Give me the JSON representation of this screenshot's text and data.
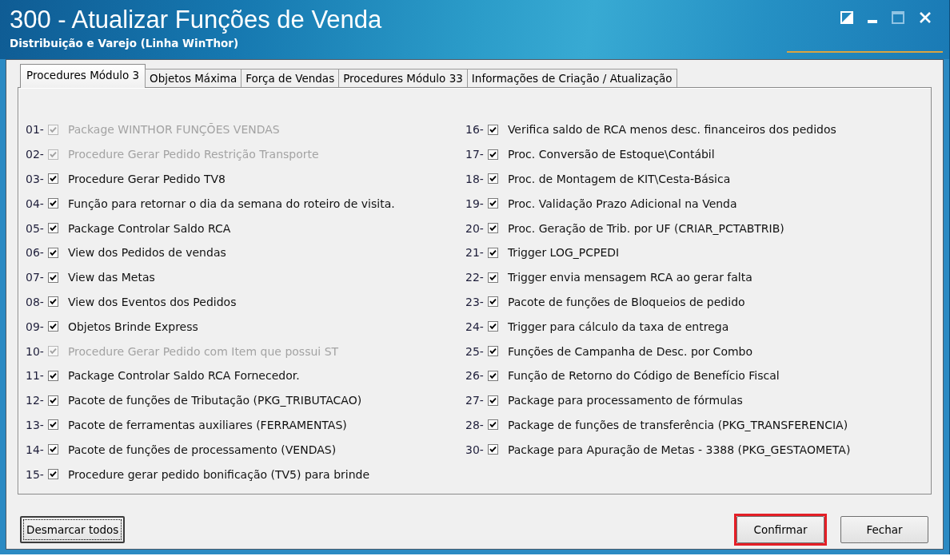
{
  "window": {
    "title": "300 - Atualizar Funções de Venda",
    "subtitle": "Distribuição e Varejo (Linha WinThor)"
  },
  "window_controls": [
    {
      "kind": "theme",
      "disabled": false
    },
    {
      "kind": "minimize",
      "disabled": false
    },
    {
      "kind": "maximize",
      "disabled": true
    },
    {
      "kind": "close",
      "disabled": false
    }
  ],
  "tabs": [
    {
      "label": "Procedures Módulo 3",
      "selected": true
    },
    {
      "label": "Objetos Máxima",
      "selected": false
    },
    {
      "label": "Força de Vendas",
      "selected": false
    },
    {
      "label": "Procedures Módulo 33",
      "selected": false
    },
    {
      "label": "Informações de Criação / Atualização",
      "selected": false
    }
  ],
  "columns": [
    {
      "items": [
        {
          "number": "01-",
          "label": "Package WINTHOR FUNÇÕES VENDAS",
          "checked": true,
          "disabled": true
        },
        {
          "number": "02-",
          "label": "Procedure Gerar Pedido Restrição Transporte",
          "checked": true,
          "disabled": true
        },
        {
          "number": "03-",
          "label": "Procedure Gerar Pedido TV8",
          "checked": true,
          "disabled": false
        },
        {
          "number": "04-",
          "label": "Função para retornar o dia da semana do roteiro de visita.",
          "checked": true,
          "disabled": false
        },
        {
          "number": "05-",
          "label": "Package Controlar Saldo RCA",
          "checked": true,
          "disabled": false
        },
        {
          "number": "06-",
          "label": "View dos Pedidos de vendas",
          "checked": true,
          "disabled": false
        },
        {
          "number": "07-",
          "label": "View das Metas",
          "checked": true,
          "disabled": false
        },
        {
          "number": "08-",
          "label": "View dos Eventos dos Pedidos",
          "checked": true,
          "disabled": false
        },
        {
          "number": "09-",
          "label": "Objetos Brinde Express",
          "checked": true,
          "disabled": false
        },
        {
          "number": "10-",
          "label": "Procedure Gerar Pedido com Item que possui ST",
          "checked": true,
          "disabled": true
        },
        {
          "number": "11-",
          "label": "Package Controlar Saldo RCA Fornecedor.",
          "checked": true,
          "disabled": false
        },
        {
          "number": "12-",
          "label": "Pacote de funções de Tributação (PKG_TRIBUTACAO)",
          "checked": true,
          "disabled": false
        },
        {
          "number": "13-",
          "label": "Pacote de ferramentas auxiliares (FERRAMENTAS)",
          "checked": true,
          "disabled": false
        },
        {
          "number": "14-",
          "label": "Pacote de funções de processamento (VENDAS)",
          "checked": true,
          "disabled": false
        },
        {
          "number": "15-",
          "label": "Procedure gerar pedido bonificação (TV5) para brinde",
          "checked": true,
          "disabled": false
        }
      ]
    },
    {
      "items": [
        {
          "number": "16-",
          "label": "Verifica saldo de RCA menos desc. financeiros dos pedidos",
          "checked": true,
          "disabled": false
        },
        {
          "number": "17-",
          "label": "Proc. Conversão de Estoque\\Contábil",
          "checked": true,
          "disabled": false
        },
        {
          "number": "18-",
          "label": "Proc. de Montagem de KIT\\Cesta-Básica",
          "checked": true,
          "disabled": false
        },
        {
          "number": "19-",
          "label": "Proc. Validação Prazo Adicional na Venda",
          "checked": true,
          "disabled": false
        },
        {
          "number": "20-",
          "label": "Proc. Geração de Trib. por UF (CRIAR_PCTABTRIB)",
          "checked": true,
          "disabled": false
        },
        {
          "number": "21-",
          "label": "Trigger LOG_PCPEDI",
          "checked": true,
          "disabled": false
        },
        {
          "number": "22-",
          "label": "Trigger envia mensagem RCA ao gerar falta",
          "checked": true,
          "disabled": false
        },
        {
          "number": "23-",
          "label": "Pacote de funções de Bloqueios de pedido",
          "checked": true,
          "disabled": false
        },
        {
          "number": "24-",
          "label": "Trigger para cálculo da taxa de entrega",
          "checked": true,
          "disabled": false
        },
        {
          "number": "25-",
          "label": "Funções de Campanha de Desc. por Combo",
          "checked": true,
          "disabled": false
        },
        {
          "number": "26-",
          "label": "Função de Retorno do Código de Benefício Fiscal",
          "checked": true,
          "disabled": false
        },
        {
          "number": "27-",
          "label": "Package para processamento de fórmulas",
          "checked": true,
          "disabled": false
        },
        {
          "number": "28-",
          "label": "Package de funções de transferência (PKG_TRANSFERENCIA)",
          "checked": true,
          "disabled": false
        },
        {
          "number": "30-",
          "label": "Package para Apuração de Metas - 3388 (PKG_GESTAOMETA)",
          "checked": true,
          "disabled": false
        }
      ]
    }
  ],
  "footer": {
    "left_buttons": [
      {
        "label": "Desmarcar todos",
        "focused": true,
        "highlighted": false
      }
    ],
    "right_buttons": [
      {
        "label": "Confirmar",
        "focused": false,
        "highlighted": true
      },
      {
        "label": "Fechar",
        "focused": false,
        "highlighted": false
      }
    ]
  }
}
